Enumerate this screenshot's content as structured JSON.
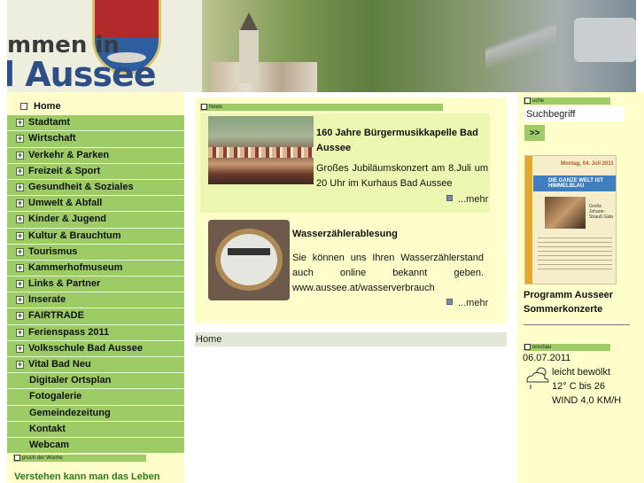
{
  "header": {
    "town_line1": "mmen in",
    "town_line2": "l Aussee"
  },
  "nav": {
    "items": [
      {
        "label": "Home",
        "type": "home"
      },
      {
        "label": "Stadtamt",
        "type": "expand"
      },
      {
        "label": "Wirtschaft",
        "type": "expand"
      },
      {
        "label": "Verkehr & Parken",
        "type": "expand"
      },
      {
        "label": "Freizeit & Sport",
        "type": "expand"
      },
      {
        "label": "Gesundheit & Soziales",
        "type": "expand"
      },
      {
        "label": "Umwelt & Abfall",
        "type": "expand"
      },
      {
        "label": "Kinder & Jugend",
        "type": "expand"
      },
      {
        "label": "Kultur & Brauchtum",
        "type": "expand"
      },
      {
        "label": "Tourismus",
        "type": "expand"
      },
      {
        "label": "Kammerhofmuseum",
        "type": "expand"
      },
      {
        "label": "Links & Partner",
        "type": "expand"
      },
      {
        "label": "Inserate",
        "type": "expand"
      },
      {
        "label": "FAIRTRADE",
        "type": "expand"
      },
      {
        "label": "Ferienspass 2011",
        "type": "expand"
      },
      {
        "label": "Volksschule Bad Aussee",
        "type": "expand"
      },
      {
        "label": "Vital Bad Neu",
        "type": "expand"
      },
      {
        "label": "Digitaler Ortsplan",
        "type": "plain"
      },
      {
        "label": "Fotogalerie",
        "type": "plain"
      },
      {
        "label": "Gemeindezeitung",
        "type": "plain"
      },
      {
        "label": "Kontakt",
        "type": "plain"
      },
      {
        "label": "Webcam",
        "type": "plain"
      }
    ]
  },
  "quote_box": {
    "header": "pruch der Woche",
    "text": "Verstehen kann man das Leben"
  },
  "news": {
    "header": "News",
    "items": [
      {
        "title": "160 Jahre Bürgermusikkapelle Bad Aussee",
        "text": "Großes Jubiläumskonzert am 8.Juli um 20 Uhr im Kurhaus Bad Aussee",
        "more": "...mehr"
      },
      {
        "title": "Wasserzählerablesung",
        "text": "Sie können uns Ihren Wasserzählerstand auch online bekannt geben. www.aussee.at/wasserverbrauch",
        "more": "...mehr"
      }
    ]
  },
  "breadcrumb": "Home",
  "search": {
    "header": "uche",
    "value": "Suchbegriff",
    "button": ">>"
  },
  "poster": {
    "top_text": "Montag, 04. Juli 2011",
    "banner_text": "DIE GANZE WELT IST HIMMELBLAU",
    "side_text": "Große Johann-Strauß Gala"
  },
  "program_title": "Programm Ausseer Sommerkonzerte",
  "weather": {
    "header": "orschau",
    "date": "06.07.2011",
    "condition": "leicht bewölkt",
    "temp": "12° C bis 26",
    "wind": "WIND 4,0 KM/H"
  }
}
